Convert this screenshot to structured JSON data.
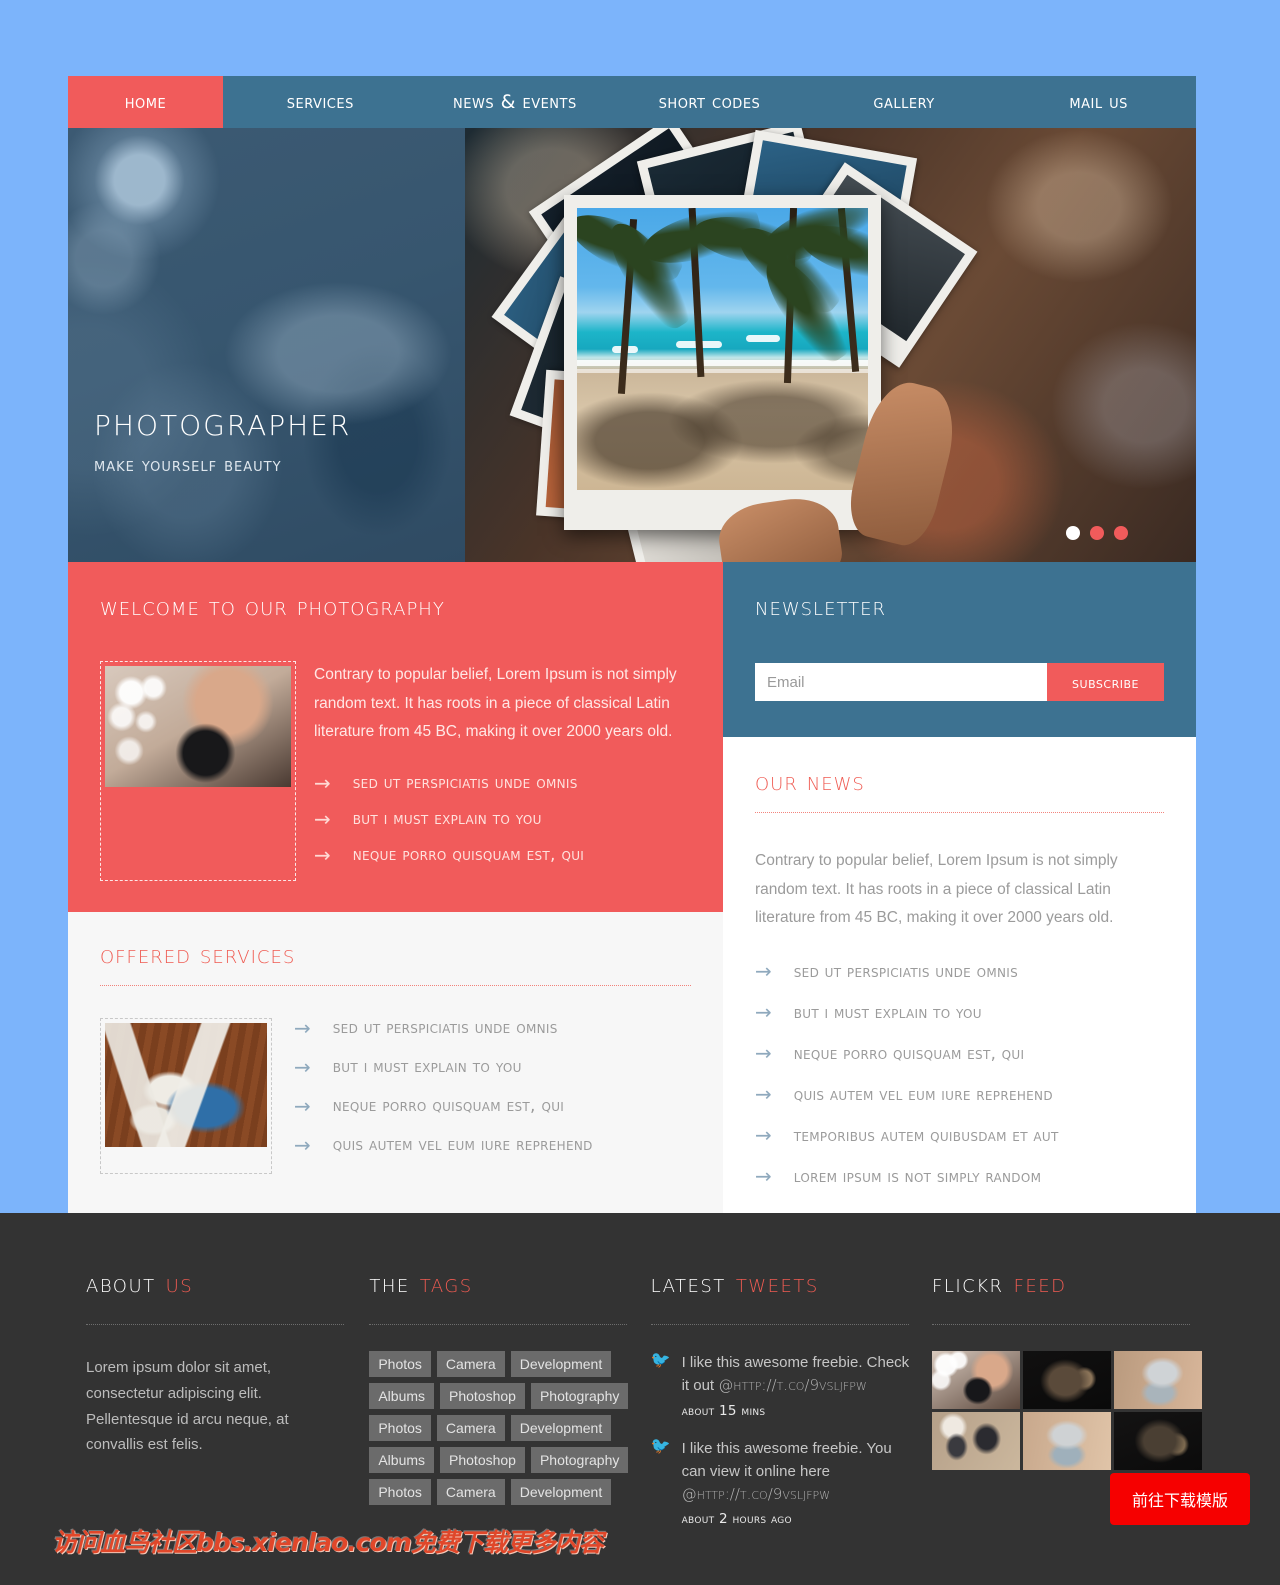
{
  "nav": {
    "items": [
      {
        "label": "Home",
        "active": true
      },
      {
        "label": "Services",
        "active": false
      },
      {
        "label": "News & Events",
        "active": false
      },
      {
        "label": "Short Codes",
        "active": false
      },
      {
        "label": "Gallery",
        "active": false
      },
      {
        "label": "Mail Us",
        "active": false
      }
    ]
  },
  "hero": {
    "title": "Photographer",
    "subtitle": "Make Yourself Beauty",
    "dots": [
      {
        "active": true,
        "color": "#ffffff"
      },
      {
        "active": false,
        "color": "#f15b5b"
      },
      {
        "active": false,
        "color": "#f15b5b"
      }
    ]
  },
  "welcome": {
    "heading": "Welcome to our Photography",
    "paragraph": "Contrary to popular belief, Lorem Ipsum is not simply random text. It has roots in a piece of classical Latin literature from 45 BC, making it over 2000 years old.",
    "image_alt": "photographer-with-camera",
    "bullets": [
      "Sed ut perspiciatis unde omnis",
      "But I must explain to you",
      "Neque porro quisquam est, qui"
    ]
  },
  "services": {
    "heading": "Offered Services",
    "image_alt": "polaroid-photos-on-wood",
    "bullets": [
      "Sed ut perspiciatis unde omnis",
      "But I must explain to you",
      "Neque porro quisquam est, qui",
      "Quis autem vel eum iure reprehend"
    ]
  },
  "newsletter": {
    "heading": "Newsletter",
    "email_value": "",
    "email_placeholder": "Email",
    "subscribe_label": "Subscribe"
  },
  "news": {
    "heading": "Our News",
    "paragraph": "Contrary to popular belief, Lorem Ipsum is not simply random text. It has roots in a piece of classical Latin literature from 45 BC, making it over 2000 years old.",
    "bullets": [
      "Sed ut perspiciatis unde omnis",
      "But I must explain to you",
      "Neque porro quisquam est, qui",
      "Quis autem vel eum iure reprehend",
      "Temporibus autem quibusdam et aut",
      "Lorem ipsum is not simply random"
    ]
  },
  "footer": {
    "about": {
      "title_white": "About",
      "title_red": "Us",
      "text": "Lorem ipsum dolor sit amet, consectetur adipiscing elit. Pellentesque id arcu neque, at convallis est felis."
    },
    "tags": {
      "title_white": "The",
      "title_red": "Tags",
      "items": [
        "Photos",
        "Camera",
        "Development",
        "Albums",
        "Photoshop",
        "Photography",
        "Photos",
        "Camera",
        "Development",
        "Albums",
        "Photoshop",
        "Photography",
        "Photos",
        "Camera",
        "Development"
      ]
    },
    "tweets": {
      "title_white": "Latest",
      "title_red": "Tweets",
      "items": [
        {
          "text": "I like this awesome freebie. Check it out ",
          "link": "@http://t.co/9vslJfpw",
          "time": "About 15 mins"
        },
        {
          "text": "I like this awesome freebie. You can view it online here ",
          "link": "@http://t.co/9vslJfpw",
          "time": "About 2 hours ago"
        }
      ]
    },
    "flickr": {
      "title_white": "Flickr",
      "title_red": "Feed",
      "thumbs": [
        "photographer-portrait",
        "vintage-folding-camera",
        "silver-rangefinder-camera",
        "camera-accessories-flatlay",
        "rangefinder-camera-reflection",
        "antique-bellows-camera"
      ]
    }
  },
  "overlay": {
    "watermark": "访问血鸟社区bbs.xienlao.com免费下载更多内容",
    "download_button": "前往下载模版"
  },
  "colors": {
    "coral": "#f15b5b",
    "steel_blue": "#3d7291",
    "page_background": "#7cb4fb",
    "footer_background": "#333333",
    "heading_red": "#ef5b52",
    "download_red": "#f60000"
  }
}
